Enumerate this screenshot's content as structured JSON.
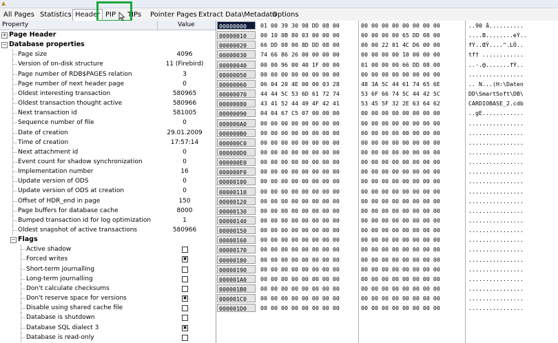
{
  "tabs": [
    "All Pages",
    "Statistics",
    "Header",
    "PIP",
    "TIPs",
    "Pointer Pages",
    "Extract Data\\Metadata",
    "Options"
  ],
  "columns": {
    "property": "Property",
    "value": "Value"
  },
  "properties": [
    {
      "name": "Page Header",
      "value": "",
      "level": 0,
      "section": true,
      "expander": "+"
    },
    {
      "name": "Database properties",
      "value": "",
      "level": 0,
      "section": true,
      "expander": "-"
    },
    {
      "name": "Page size",
      "value": "4096",
      "level": 1
    },
    {
      "name": "Version of on-disk structure",
      "value": "11 (Firebird)",
      "level": 1
    },
    {
      "name": "Page number of RDB$PAGES relation",
      "value": "3",
      "level": 1
    },
    {
      "name": "Page number of next header page",
      "value": "0",
      "level": 1
    },
    {
      "name": "Oldest interesting transaction",
      "value": "580965",
      "level": 1
    },
    {
      "name": "Oldest transaction thought active",
      "value": "580966",
      "level": 1
    },
    {
      "name": "Next transaction id",
      "value": "581005",
      "level": 1
    },
    {
      "name": "Sequence number of file",
      "value": "0",
      "level": 1
    },
    {
      "name": "Date of creation",
      "value": "29.01.2009",
      "level": 1
    },
    {
      "name": "Time of creation",
      "value": "17:57:14",
      "level": 1
    },
    {
      "name": "Next attachment id",
      "value": "0",
      "level": 1
    },
    {
      "name": "Event count for shadow synchronization",
      "value": "0",
      "level": 1
    },
    {
      "name": "Implementation number",
      "value": "16",
      "level": 1
    },
    {
      "name": "Update version of ODS",
      "value": "0",
      "level": 1
    },
    {
      "name": "Update version of ODS at creation",
      "value": "0",
      "level": 1
    },
    {
      "name": "Offset of HDR_end in page",
      "value": "150",
      "level": 1
    },
    {
      "name": "Page buffers for database cache",
      "value": "8000",
      "level": 1
    },
    {
      "name": "Bumped transaction id for log optimization",
      "value": "1",
      "level": 1
    },
    {
      "name": "Oldest snapshot of active transactions",
      "value": "580966",
      "level": 1
    },
    {
      "name": "Flags",
      "value": "",
      "level": 1,
      "section": true,
      "expander": "-"
    },
    {
      "name": "Active shadow",
      "checked": false,
      "level": 2
    },
    {
      "name": "Forced writes",
      "checked": true,
      "level": 2
    },
    {
      "name": "Short-term journalling",
      "checked": false,
      "level": 2
    },
    {
      "name": "Long-term journalling",
      "checked": false,
      "level": 2
    },
    {
      "name": "Don't calculate checksums",
      "checked": false,
      "level": 2
    },
    {
      "name": "Don't reserve space for versions",
      "checked": true,
      "level": 2
    },
    {
      "name": "Disable using shared cache file",
      "checked": false,
      "level": 2
    },
    {
      "name": "Database is shutdown",
      "checked": false,
      "level": 2
    },
    {
      "name": "Database SQL dialect 3",
      "checked": true,
      "level": 2
    },
    {
      "name": "Database is read-only",
      "checked": false,
      "level": 2
    }
  ],
  "hex_rows": [
    {
      "offset": "00000000",
      "b1": "01 00 39 30 98 DD 08 00",
      "b2": "00 00 00 00 00 00 00 00",
      "ascii": "..90 å.........."
    },
    {
      "offset": "00000010",
      "b1": "00 10 0B 80 03 00 00 00",
      "b2": "00 00 00 00 65 DD 08 00",
      "ascii": "....B........eÝ.."
    },
    {
      "offset": "00000020",
      "b1": "66 DD 08 00 8D DD 08 00",
      "b2": "00 00 22 01 4C D6 00 00",
      "ascii": "fÝ..ŒÝ....\".LÖ.."
    },
    {
      "offset": "00000030",
      "b1": "74 66 86 26 00 00 00 00",
      "b2": "00 00 00 00 10 00 00 00",
      "ascii": "tf† ............"
    },
    {
      "offset": "00000040",
      "b1": "00 00 96 00 40 1F 00 00",
      "b2": "01 00 00 00 66 DD 08 00",
      "ascii": "..-.@.......fÝ.."
    },
    {
      "offset": "00000050",
      "b1": "00 00 00 00 00 00 00 00",
      "b2": "00 00 00 00 00 00 00 00",
      "ascii": "................"
    },
    {
      "offset": "00000060",
      "b1": "06 04 20 4E 00 00 03 28",
      "b2": "48 3A 5C 44 61 74 65 6E",
      "ascii": ".. N...(H:\\Daten"
    },
    {
      "offset": "00000070",
      "b1": "44 44 5C 53 6D 61 72 74",
      "b2": "53 6F 66 74 5C 44 42 5C",
      "ascii": "DD\\SmartSoft\\DB\\"
    },
    {
      "offset": "00000080",
      "b1": "43 41 52 44 49 4F 42 41",
      "b2": "53 45 5F 32 2E 63 64 62",
      "ascii": "CARDIOBASE_2.cdb"
    },
    {
      "offset": "00000090",
      "b1": "04 04 67 C5 07 00 00 00",
      "b2": "00 00 00 00 00 00 00 00",
      "ascii": "..gE............"
    },
    {
      "offset": "000000A0",
      "b1": "00 00 00 00 00 00 00 00",
      "b2": "00 00 00 00 00 00 00 00",
      "ascii": "................"
    },
    {
      "offset": "000000B0",
      "b1": "00 00 00 00 00 00 00 00",
      "b2": "00 00 00 00 00 00 00 00",
      "ascii": "................"
    },
    {
      "offset": "000000C0",
      "b1": "00 00 00 00 00 00 00 00",
      "b2": "00 00 00 00 00 00 00 00",
      "ascii": "................"
    },
    {
      "offset": "000000D0",
      "b1": "00 00 00 00 00 00 00 00",
      "b2": "00 00 00 00 00 00 00 00",
      "ascii": "................"
    },
    {
      "offset": "000000E0",
      "b1": "00 00 00 00 00 00 00 00",
      "b2": "00 00 00 00 00 00 00 00",
      "ascii": "................"
    },
    {
      "offset": "000000F0",
      "b1": "00 00 00 00 00 00 00 00",
      "b2": "00 00 00 00 00 00 00 00",
      "ascii": "................"
    },
    {
      "offset": "00000100",
      "b1": "00 00 00 00 00 00 00 00",
      "b2": "00 00 00 00 00 00 00 00",
      "ascii": "................"
    },
    {
      "offset": "00000110",
      "b1": "00 00 00 00 00 00 00 00",
      "b2": "00 00 00 00 00 00 00 00",
      "ascii": "................"
    },
    {
      "offset": "00000120",
      "b1": "00 00 00 00 00 00 00 00",
      "b2": "00 00 00 00 00 00 00 00",
      "ascii": "................"
    },
    {
      "offset": "00000130",
      "b1": "00 00 00 00 00 00 00 00",
      "b2": "00 00 00 00 00 00 00 00",
      "ascii": "................"
    },
    {
      "offset": "00000140",
      "b1": "00 00 00 00 00 00 00 00",
      "b2": "00 00 00 00 00 00 00 00",
      "ascii": "................"
    },
    {
      "offset": "00000150",
      "b1": "00 00 00 00 00 00 00 00",
      "b2": "00 00 00 00 00 00 00 00",
      "ascii": "................"
    },
    {
      "offset": "00000160",
      "b1": "00 00 00 00 00 00 00 00",
      "b2": "00 00 00 00 00 00 00 00",
      "ascii": "................"
    },
    {
      "offset": "00000170",
      "b1": "00 00 00 00 00 00 00 00",
      "b2": "00 00 00 00 00 00 00 00",
      "ascii": "................"
    },
    {
      "offset": "00000180",
      "b1": "00 00 00 00 00 00 00 00",
      "b2": "00 00 00 00 00 00 00 00",
      "ascii": "................"
    },
    {
      "offset": "00000190",
      "b1": "00 00 00 00 00 00 00 00",
      "b2": "00 00 00 00 00 00 00 00",
      "ascii": "................"
    },
    {
      "offset": "000001A0",
      "b1": "00 00 00 00 00 00 00 00",
      "b2": "00 00 00 00 00 00 00 00",
      "ascii": "................"
    },
    {
      "offset": "000001B0",
      "b1": "00 00 00 00 00 00 00 00",
      "b2": "00 00 00 00 00 00 00 00",
      "ascii": "................"
    },
    {
      "offset": "000001C0",
      "b1": "00 00 00 00 00 00 00 00",
      "b2": "00 00 00 00 00 00 00 00",
      "ascii": "................"
    },
    {
      "offset": "000001D0",
      "b1": "00 00 00 00 00 00 00 00",
      "b2": "00 00 00 00 00 00 00 00",
      "ascii": "................"
    }
  ],
  "colors": {
    "highlight_box": "#1aa83c",
    "offset_active_bg": "#0d1a3a",
    "offset_bg": "#e4e4e4"
  }
}
